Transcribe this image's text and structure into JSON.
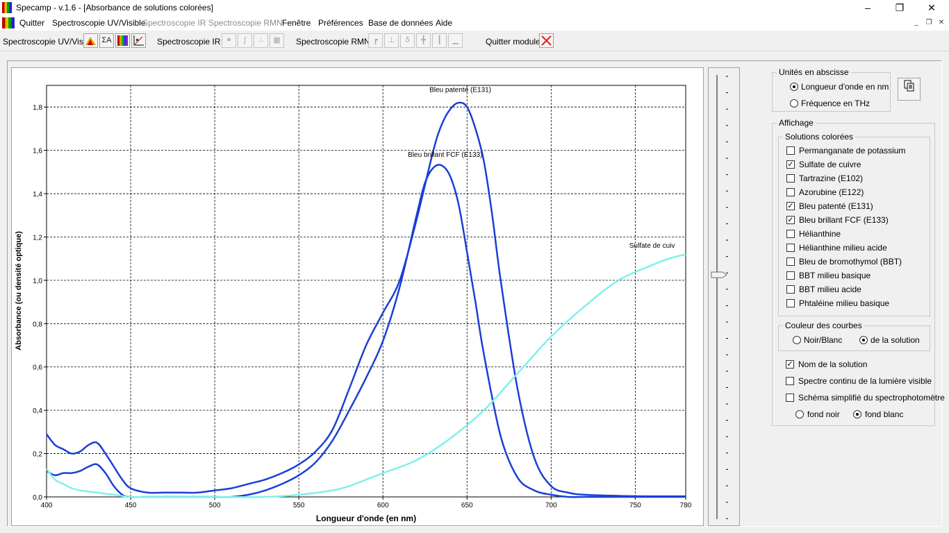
{
  "window": {
    "title": "Specamp - v.1.6 - [Absorbance de solutions colorées]"
  },
  "menu": {
    "items": [
      {
        "label": "Quitter",
        "disabled": false
      },
      {
        "label": "Spectroscopie UV/Visible",
        "disabled": false
      },
      {
        "label": "Spectroscopie IR",
        "disabled": true
      },
      {
        "label": "Spectroscopie RMN",
        "disabled": true
      },
      {
        "label": "Fenêtre",
        "disabled": false
      },
      {
        "label": "Préférences",
        "disabled": false
      },
      {
        "label": "Base de données",
        "disabled": false
      },
      {
        "label": "Aide",
        "disabled": false
      }
    ]
  },
  "toolbar": {
    "uv_label": "Spectroscopie UV/Vis :",
    "uv_sigma_label": "ΣA",
    "ir_label": "Spectroscopie IR :",
    "rmn_label": "Spectroscopie RMN :",
    "rmn_delta_label": "δ",
    "quit_label": "Quitter module :"
  },
  "right_panel": {
    "units_group_title": "Unités en abscisse",
    "unit_wavelength": "Longueur d'onde en nm",
    "unit_frequency": "Fréquence en THz",
    "unit_selected": "wavelength",
    "display_group_title": "Affichage",
    "solutions_group_title": "Solutions colorées",
    "solutions": [
      {
        "label": "Permanganate de potassium",
        "checked": false
      },
      {
        "label": "Sulfate de cuivre",
        "checked": true
      },
      {
        "label": "Tartrazine (E102)",
        "checked": false
      },
      {
        "label": "Azorubine (E122)",
        "checked": false
      },
      {
        "label": "Bleu patenté (E131)",
        "checked": true
      },
      {
        "label": "Bleu brillant FCF (E133)",
        "checked": true
      },
      {
        "label": "Hélianthine",
        "checked": false
      },
      {
        "label": "Hélianthine milieu acide",
        "checked": false
      },
      {
        "label": "Bleu de bromothymol (BBT)",
        "checked": false
      },
      {
        "label": "BBT milieu basique",
        "checked": false
      },
      {
        "label": "BBT milieu acide",
        "checked": false
      },
      {
        "label": "Phtaléine milieu basique",
        "checked": false
      }
    ],
    "curve_color_group_title": "Couleur des courbes",
    "curve_bw": "Noir/Blanc",
    "curve_solution": "de la solution",
    "curve_selected": "solution",
    "opt_name": {
      "label": "Nom de la solution",
      "checked": true
    },
    "opt_spectrum": {
      "label": "Spectre continu de la lumière visible",
      "checked": false
    },
    "opt_schema": {
      "label": "Schéma simplifié du spectrophotomètre",
      "checked": false
    },
    "bg_black": "fond noir",
    "bg_white": "fond blanc",
    "bg_selected": "white"
  },
  "slider": {
    "value": 0.55
  },
  "colors": {
    "blue_curve": "#1a3fd6",
    "cyan_curve": "#7ff0ec",
    "grid": "#000000"
  },
  "chart_data": {
    "type": "line",
    "xlabel": "Longueur d'onde (en nm)",
    "ylabel": "Absorbance (ou densité optique)",
    "xlim": [
      400,
      780
    ],
    "ylim": [
      0,
      1.9
    ],
    "xticks": [
      400,
      450,
      500,
      550,
      600,
      650,
      700,
      750,
      780
    ],
    "xtick_labels": [
      "400",
      "450",
      "500",
      "550",
      "600",
      "650",
      "700",
      "750",
      "780"
    ],
    "yticks": [
      0,
      0.2,
      0.4,
      0.6,
      0.8,
      1.0,
      1.2,
      1.4,
      1.6,
      1.8
    ],
    "ytick_labels": [
      "0,0",
      "0,2",
      "0,4",
      "0,6",
      "0,8",
      "1,0",
      "1,2",
      "1,4",
      "1,6",
      "1,8"
    ],
    "grid": true,
    "series": [
      {
        "name": "Bleu patenté (E131)",
        "color": "#1a3fd6",
        "x": [
          400,
          405,
          410,
          415,
          420,
          425,
          430,
          435,
          440,
          445,
          450,
          460,
          470,
          480,
          490,
          500,
          510,
          520,
          530,
          540,
          550,
          560,
          570,
          580,
          590,
          600,
          610,
          620,
          630,
          635,
          640,
          645,
          650,
          655,
          660,
          665,
          670,
          680,
          690,
          700,
          710,
          720,
          740,
          760,
          780
        ],
        "y": [
          0.29,
          0.24,
          0.22,
          0.2,
          0.21,
          0.24,
          0.25,
          0.2,
          0.14,
          0.08,
          0.04,
          0.02,
          0.02,
          0.02,
          0.02,
          0.03,
          0.04,
          0.06,
          0.08,
          0.11,
          0.15,
          0.21,
          0.31,
          0.5,
          0.7,
          0.85,
          1.0,
          1.28,
          1.6,
          1.72,
          1.79,
          1.82,
          1.8,
          1.7,
          1.55,
          1.3,
          1.0,
          0.5,
          0.18,
          0.05,
          0.02,
          0.01,
          0.005,
          0.003,
          0.003
        ]
      },
      {
        "name": "Bleu brillant FCF (E133)",
        "color": "#1a3fd6",
        "x": [
          400,
          405,
          410,
          415,
          420,
          425,
          430,
          435,
          440,
          445,
          450,
          460,
          470,
          480,
          490,
          500,
          510,
          520,
          530,
          540,
          550,
          560,
          570,
          580,
          590,
          600,
          610,
          620,
          625,
          630,
          635,
          640,
          645,
          650,
          655,
          660,
          670,
          680,
          690,
          700,
          710,
          720,
          740,
          760,
          780
        ],
        "y": [
          0.12,
          0.1,
          0.11,
          0.11,
          0.12,
          0.14,
          0.15,
          0.11,
          0.05,
          0.01,
          0.0,
          0.0,
          0.0,
          0.0,
          0.0,
          0.0,
          0.0,
          0.01,
          0.03,
          0.06,
          0.1,
          0.16,
          0.26,
          0.4,
          0.55,
          0.72,
          0.97,
          1.3,
          1.45,
          1.52,
          1.53,
          1.48,
          1.35,
          1.13,
          0.9,
          0.66,
          0.28,
          0.09,
          0.03,
          0.01,
          0.0,
          0.0,
          0.0,
          0.0,
          0.0
        ]
      },
      {
        "name": "Sulfate de cuivre",
        "color": "#7ff0ec",
        "x": [
          400,
          405,
          410,
          415,
          420,
          430,
          440,
          450,
          470,
          500,
          530,
          550,
          570,
          580,
          590,
          600,
          620,
          640,
          660,
          680,
          700,
          720,
          740,
          760,
          770,
          780
        ],
        "y": [
          0.13,
          0.08,
          0.06,
          0.04,
          0.03,
          0.02,
          0.01,
          0.0,
          0.0,
          0.0,
          0.0,
          0.01,
          0.03,
          0.05,
          0.08,
          0.11,
          0.17,
          0.27,
          0.4,
          0.57,
          0.74,
          0.88,
          1.0,
          1.07,
          1.1,
          1.12
        ]
      }
    ],
    "annotations": [
      {
        "text": "Bleu patenté (E131)",
        "x": 646,
        "y": 1.87
      },
      {
        "text": "Bleu brillant FCF (E133)",
        "x": 637,
        "y": 1.57
      },
      {
        "text": "Sulfate de cuiv",
        "x": 760,
        "y": 1.15
      }
    ]
  }
}
